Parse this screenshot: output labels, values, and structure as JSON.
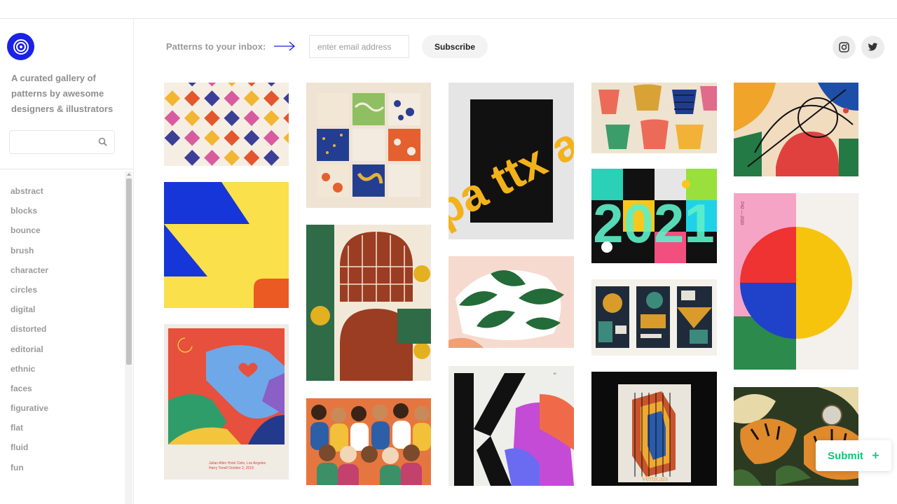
{
  "sidebar": {
    "tagline": "A curated gallery of patterns by awesome designers & illustrators",
    "search_placeholder": "",
    "tags": [
      "abstract",
      "blocks",
      "bounce",
      "brush",
      "character",
      "circles",
      "digital",
      "distorted",
      "editorial",
      "ethnic",
      "faces",
      "figurative",
      "flat",
      "fluid",
      "fun"
    ]
  },
  "header": {
    "newsletter_label": "Patterns to your inbox:",
    "email_placeholder": "enter email address",
    "subscribe_label": "Subscribe",
    "social": [
      "instagram-icon",
      "twitter-icon"
    ]
  },
  "submit_label": "Submit",
  "submit_icon": "plus-icon",
  "colors": {
    "brand": "#1a22e6",
    "submit": "#13c37a"
  },
  "gallery": {
    "poster_text_1": "pa ttx ae",
    "poster_k_text": "Kl",
    "poster_circles_side": "P42 — 2020",
    "poster_verticals": "Verticals",
    "poster_2021": "2021",
    "poster_small_caption_1": "Julian Allen  Hotel Cielo, Los Angeles",
    "poster_small_caption_2": "Harry Tonell  October 2, 2019"
  }
}
